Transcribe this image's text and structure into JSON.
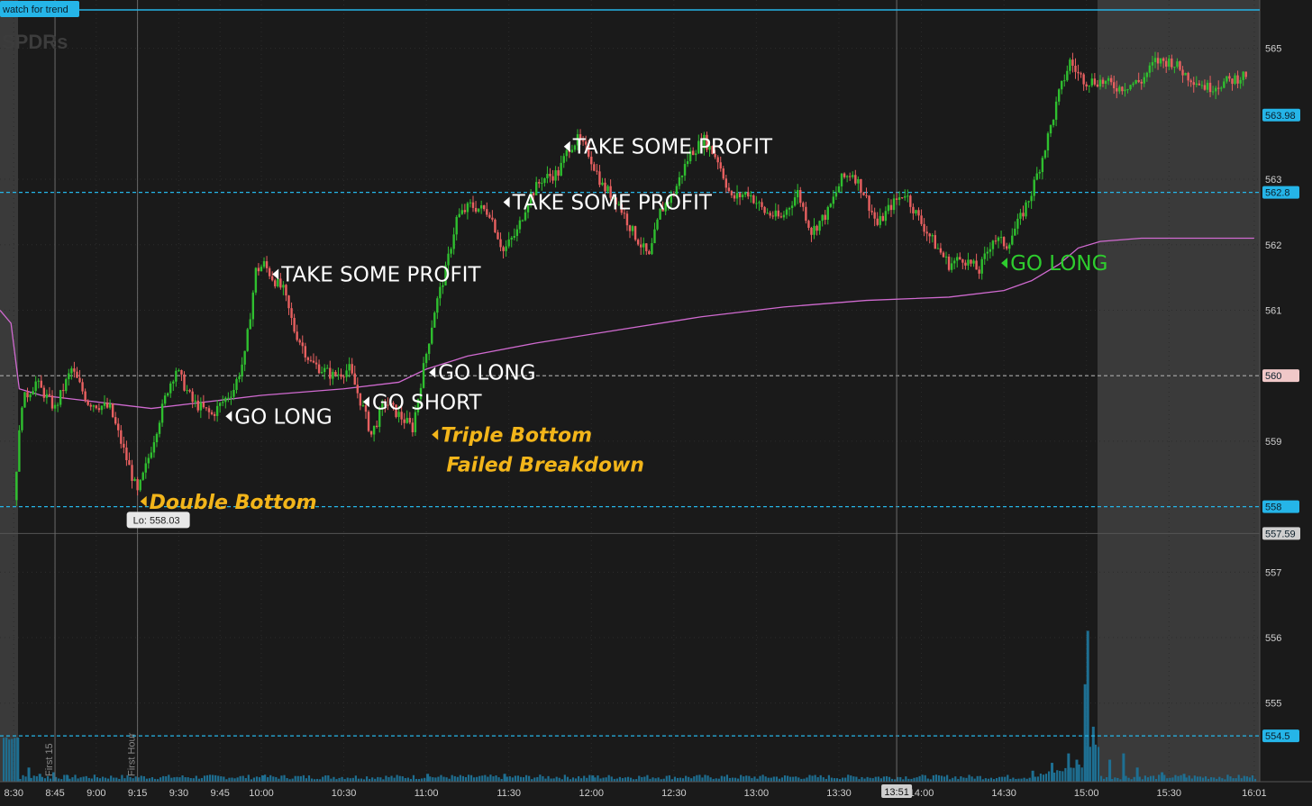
{
  "header_tag": "watch for trend",
  "watermark": "SPDRs",
  "colors": {
    "background": "#1a1a1a",
    "extended_shade": "#3a3a3a",
    "up": "#2fbf2f",
    "down": "#e86060",
    "vwap": "#d06ad0",
    "level_line": "#25b5e8",
    "volume": "#1e6f92",
    "annotation_white": "#ffffff",
    "annotation_yellow": "#f2b51a",
    "annotation_green": "#2ecc2e"
  },
  "chart_data": {
    "type": "candlestick",
    "title": "",
    "ylim": [
      553.8,
      565.6
    ],
    "y_ticks": [
      554.5,
      555,
      556,
      557,
      558,
      559,
      560,
      561,
      562,
      563,
      565
    ],
    "x_tick_labels": [
      "8:30",
      "8:45",
      "9:00",
      "9:15",
      "9:30",
      "9:45",
      "10:00",
      "10:30",
      "11:00",
      "11:30",
      "12:00",
      "12:30",
      "13:00",
      "13:30",
      "14:00",
      "14:30",
      "15:00",
      "15:30",
      "16:01"
    ],
    "x_ticks_minutes": [
      510,
      525,
      540,
      555,
      570,
      585,
      600,
      630,
      660,
      690,
      720,
      750,
      780,
      810,
      840,
      870,
      900,
      930,
      961
    ],
    "x_range_minutes": [
      505,
      963
    ],
    "session_range_minutes": [
      510,
      900
    ],
    "vertical_markers": [
      {
        "time": "8:45",
        "label": "First 15"
      },
      {
        "time": "9:15",
        "label": "First Hour"
      },
      {
        "time": "13:51",
        "label": "13:51"
      }
    ],
    "price_path": [
      [
        510,
        558.1
      ],
      [
        513,
        559.6
      ],
      [
        518,
        559.9
      ],
      [
        525,
        559.5
      ],
      [
        531,
        560.1
      ],
      [
        537,
        559.6
      ],
      [
        545,
        559.5
      ],
      [
        552,
        558.6
      ],
      [
        555,
        558.2
      ],
      [
        558,
        558.6
      ],
      [
        562,
        559.2
      ],
      [
        566,
        559.8
      ],
      [
        569,
        560.1
      ],
      [
        575,
        559.6
      ],
      [
        582,
        559.4
      ],
      [
        590,
        559.8
      ],
      [
        594,
        560.3
      ],
      [
        598,
        561.6
      ],
      [
        601,
        561.7
      ],
      [
        604,
        561.5
      ],
      [
        608,
        561.3
      ],
      [
        612,
        560.7
      ],
      [
        618,
        560.2
      ],
      [
        626,
        560.0
      ],
      [
        632,
        560.1
      ],
      [
        637,
        559.5
      ],
      [
        640,
        559.1
      ],
      [
        645,
        559.6
      ],
      [
        650,
        559.4
      ],
      [
        655,
        559.2
      ],
      [
        658,
        559.9
      ],
      [
        663,
        561.0
      ],
      [
        667,
        561.6
      ],
      [
        671,
        562.4
      ],
      [
        676,
        562.6
      ],
      [
        683,
        562.5
      ],
      [
        688,
        561.9
      ],
      [
        693,
        562.2
      ],
      [
        697,
        562.7
      ],
      [
        702,
        563.0
      ],
      [
        708,
        563.1
      ],
      [
        712,
        563.5
      ],
      [
        715,
        563.6
      ],
      [
        719,
        563.4
      ],
      [
        724,
        562.9
      ],
      [
        729,
        562.7
      ],
      [
        735,
        562.2
      ],
      [
        741,
        561.8
      ],
      [
        745,
        562.5
      ],
      [
        750,
        562.8
      ],
      [
        756,
        563.4
      ],
      [
        761,
        563.6
      ],
      [
        766,
        563.3
      ],
      [
        771,
        562.7
      ],
      [
        777,
        562.8
      ],
      [
        783,
        562.5
      ],
      [
        789,
        562.4
      ],
      [
        795,
        562.8
      ],
      [
        800,
        562.2
      ],
      [
        806,
        562.5
      ],
      [
        811,
        563.0
      ],
      [
        815,
        563.1
      ],
      [
        819,
        562.8
      ],
      [
        824,
        562.3
      ],
      [
        829,
        562.6
      ],
      [
        834,
        562.8
      ],
      [
        839,
        562.4
      ],
      [
        845,
        562.0
      ],
      [
        850,
        561.7
      ],
      [
        855,
        561.8
      ],
      [
        861,
        561.6
      ],
      [
        866,
        562.1
      ],
      [
        871,
        562.0
      ],
      [
        876,
        562.4
      ],
      [
        880,
        562.8
      ],
      [
        883,
        563.2
      ],
      [
        887,
        563.8
      ],
      [
        890,
        564.3
      ],
      [
        894,
        564.8
      ],
      [
        897,
        564.6
      ],
      [
        900,
        564.5
      ],
      [
        905,
        564.5
      ],
      [
        912,
        564.4
      ],
      [
        920,
        564.5
      ],
      [
        925,
        564.8
      ],
      [
        931,
        564.8
      ],
      [
        936,
        564.6
      ],
      [
        944,
        564.4
      ],
      [
        952,
        564.5
      ],
      [
        958,
        564.6
      ]
    ],
    "vwap_path": [
      [
        505,
        561.0
      ],
      [
        509,
        560.8
      ],
      [
        512,
        559.8
      ],
      [
        520,
        559.7
      ],
      [
        540,
        559.6
      ],
      [
        560,
        559.5
      ],
      [
        580,
        559.6
      ],
      [
        600,
        559.7
      ],
      [
        630,
        559.8
      ],
      [
        650,
        559.9
      ],
      [
        660,
        560.1
      ],
      [
        675,
        560.3
      ],
      [
        700,
        560.5
      ],
      [
        730,
        560.7
      ],
      [
        760,
        560.9
      ],
      [
        790,
        561.05
      ],
      [
        820,
        561.15
      ],
      [
        850,
        561.2
      ],
      [
        870,
        561.3
      ],
      [
        880,
        561.45
      ],
      [
        890,
        561.7
      ],
      [
        897,
        561.95
      ],
      [
        905,
        562.05
      ],
      [
        920,
        562.1
      ],
      [
        961,
        562.1
      ]
    ],
    "horizontal_levels": [
      {
        "price": 562.8,
        "label": "562.8"
      },
      {
        "price": 560,
        "label": "560"
      },
      {
        "price": 558,
        "label": "558"
      },
      {
        "price": 554.5,
        "label": "554.5"
      }
    ],
    "price_tags": [
      {
        "price": 563.98,
        "label": "563.98"
      },
      {
        "price": 557.59,
        "label": "557.59"
      }
    ],
    "low_label": {
      "time": 555,
      "price": 558.03,
      "text": "Lo: 558.03"
    },
    "annotations": [
      {
        "text": "Double Bottom",
        "time": 556,
        "price": 558.08,
        "style": "yellow"
      },
      {
        "text": "GO LONG",
        "time": 587,
        "price": 559.38,
        "style": "white"
      },
      {
        "text": "TAKE SOME PROFIT",
        "time": 604,
        "price": 561.55,
        "style": "white"
      },
      {
        "text": "GO SHORT",
        "time": 637,
        "price": 559.6,
        "style": "white"
      },
      {
        "text": "GO LONG",
        "time": 661,
        "price": 560.05,
        "style": "white"
      },
      {
        "text": "Triple Bottom",
        "time": 662,
        "price": 559.1,
        "style": "yellow"
      },
      {
        "text": "Failed Breakdown",
        "time": 664,
        "price": 558.65,
        "style": "yellow"
      },
      {
        "text": "TAKE SOME PROFIT",
        "time": 688,
        "price": 562.65,
        "style": "white"
      },
      {
        "text": "TAKE SOME PROFIT",
        "time": 710,
        "price": 563.5,
        "style": "white"
      },
      {
        "text": "GO LONG",
        "time": 869,
        "price": 561.72,
        "style": "green"
      }
    ],
    "volume_spikes": [
      [
        511,
        0.28
      ],
      [
        515,
        0.09
      ],
      [
        519,
        0.05
      ],
      [
        524,
        0.06
      ],
      [
        529,
        0.04
      ],
      [
        600,
        0.04
      ],
      [
        660,
        0.05
      ],
      [
        688,
        0.05
      ],
      [
        720,
        0.04
      ],
      [
        880,
        0.07
      ],
      [
        887,
        0.12
      ],
      [
        893,
        0.18
      ],
      [
        896,
        0.14
      ],
      [
        899,
        0.62
      ],
      [
        900,
        0.96
      ],
      [
        902,
        0.35
      ],
      [
        908,
        0.14
      ],
      [
        913,
        0.18
      ],
      [
        918,
        0.09
      ],
      [
        927,
        0.06
      ],
      [
        935,
        0.05
      ]
    ]
  }
}
